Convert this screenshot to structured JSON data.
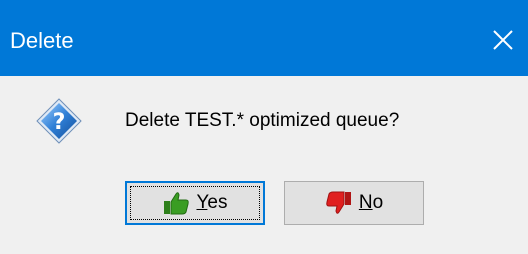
{
  "window": {
    "title": "Delete",
    "close_glyph": "✕"
  },
  "dialog": {
    "icon": "question-icon",
    "message": "Delete TEST.* optimized queue?"
  },
  "buttons": {
    "yes": {
      "label_first": "Y",
      "label_rest": "es",
      "icon": "thumbs-up-icon"
    },
    "no": {
      "label_first": "N",
      "label_rest": "o",
      "icon": "thumbs-down-icon"
    }
  },
  "colors": {
    "titlebar": "#0078d7",
    "client": "#f0f0f0",
    "button_face": "#e1e1e1",
    "default_border": "#0078d7",
    "thumbs_up": "#3a9d23",
    "thumbs_down": "#e01f1f"
  }
}
